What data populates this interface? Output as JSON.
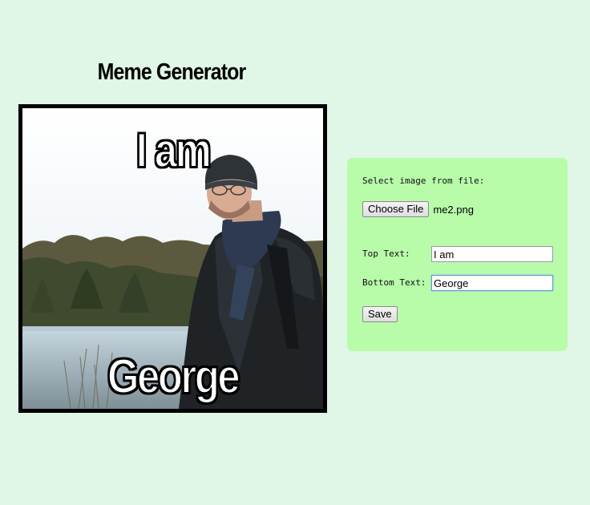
{
  "header": {
    "title": "Meme Generator"
  },
  "meme": {
    "top_text": "I am",
    "bottom_text": "George"
  },
  "form": {
    "select_label": "Select image from file:",
    "choose_file_label": "Choose File",
    "file_name": "me2.png",
    "top_text_label": "Top Text:",
    "top_text_value": "I am",
    "bottom_text_label": "Bottom Text:",
    "bottom_text_value": "George",
    "save_label": "Save"
  },
  "colors": {
    "page_background": "#e0f6e6",
    "panel_background": "#b8fcaa",
    "meme_border": "#000000",
    "meme_text": "#ffffff"
  }
}
